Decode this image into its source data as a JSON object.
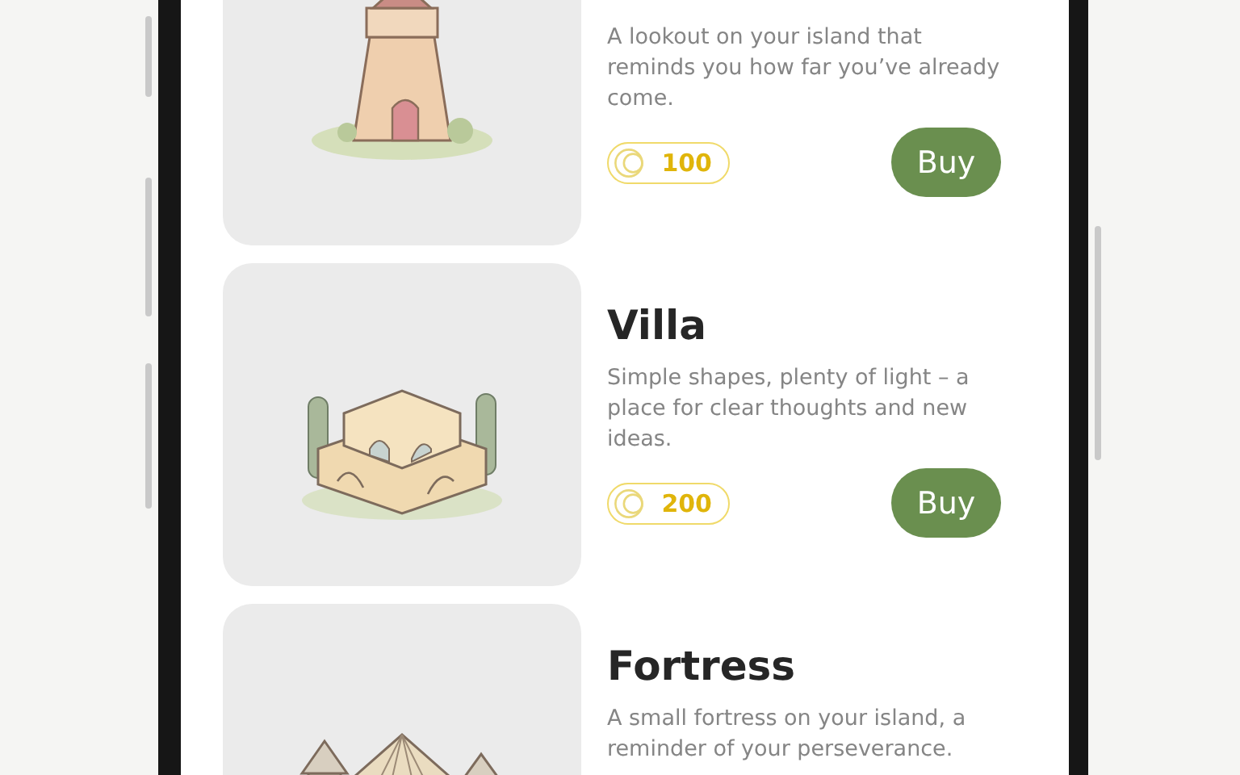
{
  "items": [
    {
      "description": "A lookout on your island that reminds you how far you’ve already come.",
      "price": "100",
      "button": "Buy"
    },
    {
      "title": "Villa",
      "description": "Simple shapes, plenty of light – a place for clear thoughts and new ideas.",
      "price": "200",
      "button": "Buy"
    },
    {
      "title": "Fortress",
      "description": "A small fortress on your island, a reminder of your perseverance."
    }
  ]
}
